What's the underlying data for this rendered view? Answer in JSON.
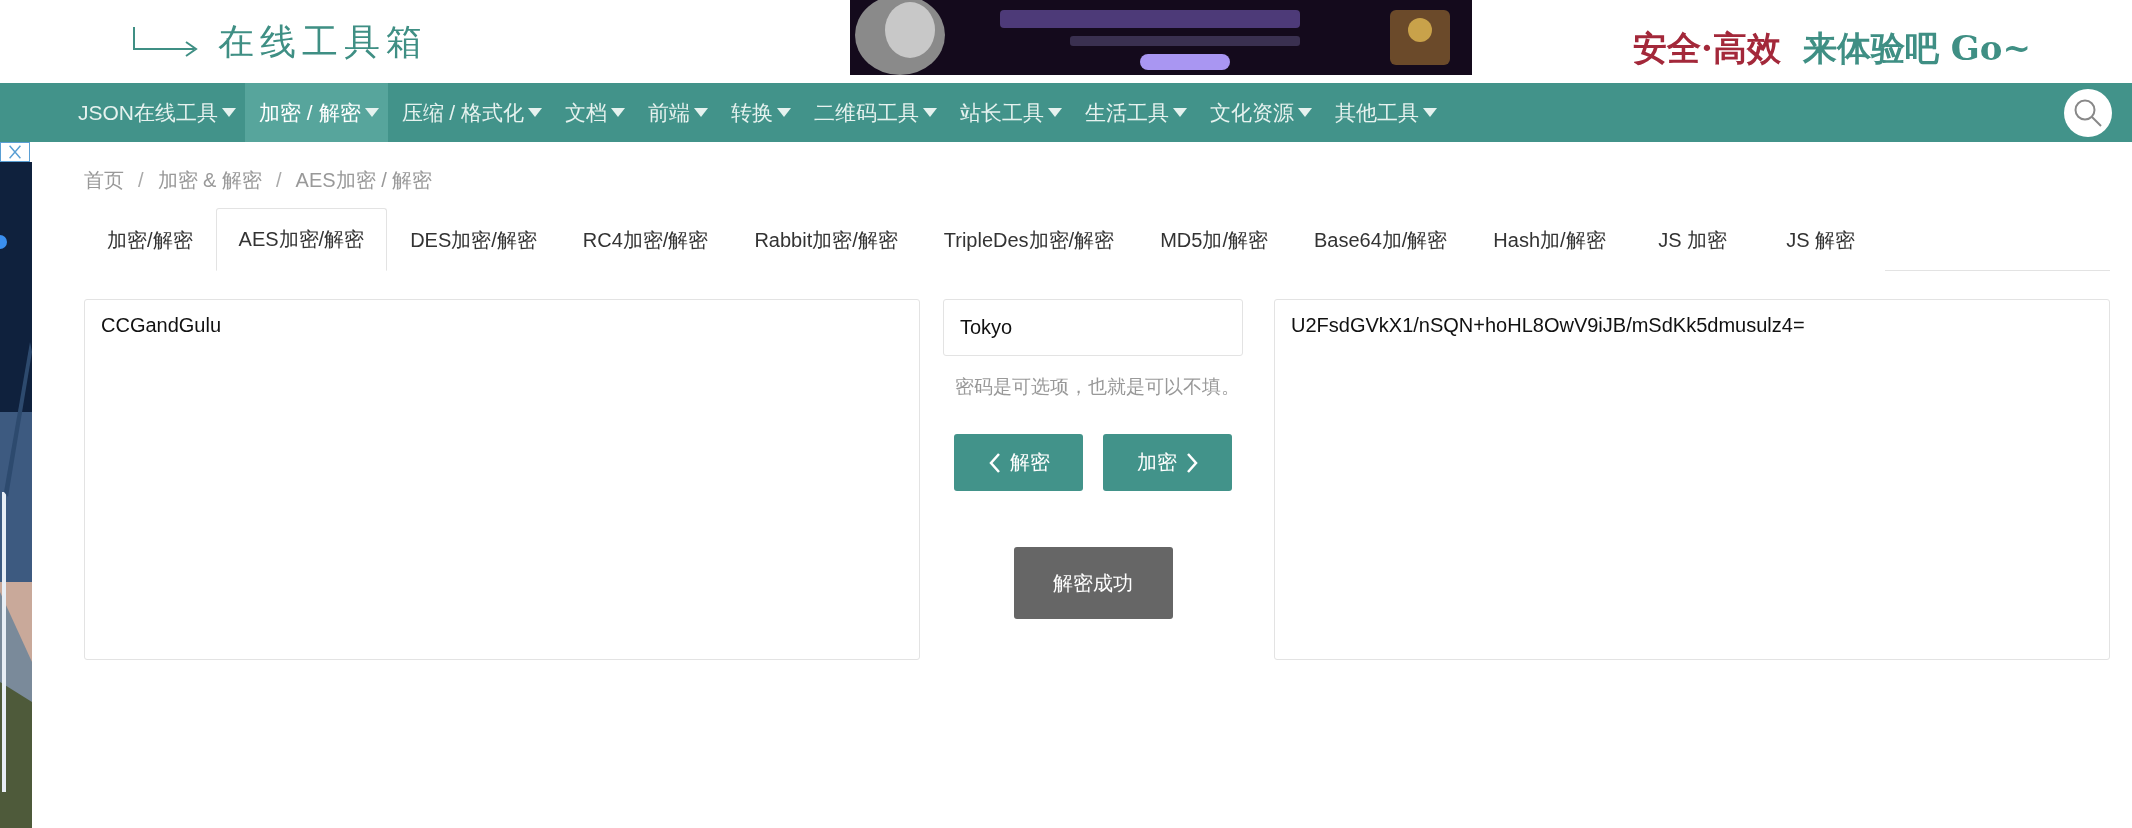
{
  "header": {
    "logo_subtitle": "在线工具箱",
    "slogan": [
      {
        "text": "安全·高效",
        "color": "#a3283a"
      },
      {
        "text": "来体验吧 Go~",
        "color": "#3f8f84"
      }
    ]
  },
  "nav": {
    "items": [
      {
        "label": "JSON在线工具",
        "selected": false
      },
      {
        "label": "加密 / 解密",
        "selected": true
      },
      {
        "label": "压缩 / 格式化",
        "selected": false
      },
      {
        "label": "文档",
        "selected": false
      },
      {
        "label": "前端",
        "selected": false
      },
      {
        "label": "转换",
        "selected": false
      },
      {
        "label": "二维码工具",
        "selected": false
      },
      {
        "label": "站长工具",
        "selected": false
      },
      {
        "label": "生活工具",
        "selected": false
      },
      {
        "label": "文化资源",
        "selected": false
      },
      {
        "label": "其他工具",
        "selected": false
      }
    ]
  },
  "breadcrumb": [
    {
      "text": "首页",
      "kind": "link"
    },
    {
      "text": "/",
      "kind": "separator"
    },
    {
      "text": "加密 & 解密",
      "kind": "link"
    },
    {
      "text": "/",
      "kind": "separator"
    },
    {
      "text": "AES加密 / 解密",
      "kind": "link"
    }
  ],
  "tabs": [
    {
      "label": "加密/解密",
      "selected": false
    },
    {
      "label": "AES加密/解密",
      "selected": true
    },
    {
      "label": "DES加密/解密",
      "selected": false
    },
    {
      "label": "RC4加密/解密",
      "selected": false
    },
    {
      "label": "Rabbit加密/解密",
      "selected": false
    },
    {
      "label": "TripleDes加密/解密",
      "selected": false
    },
    {
      "label": "MD5加/解密",
      "selected": false
    },
    {
      "label": "Base64加/解密",
      "selected": false
    },
    {
      "label": "Hash加/解密",
      "selected": false
    },
    {
      "label": "JS 加密",
      "selected": false
    },
    {
      "label": "JS 解密",
      "selected": false
    }
  ],
  "plaintext": "CCGandGulu",
  "key": {
    "value": "Tokyo",
    "hint": "密码是可选项，也就是可以不填。"
  },
  "buttons": [
    {
      "label": "解密",
      "kind": "back"
    },
    {
      "label": "加密",
      "kind": "forward"
    }
  ],
  "status": "解密成功",
  "ciphertext": "U2FsdGVkX1/nSQN+hoHL8OwV9iJB/mSdKk5dmusulz4="
}
